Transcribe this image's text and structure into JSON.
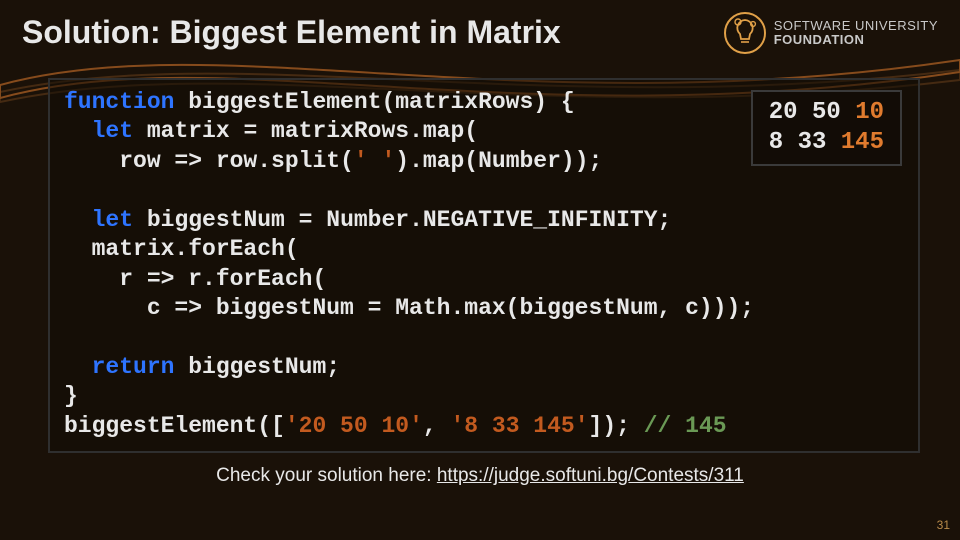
{
  "header": {
    "title": "Solution: Biggest Element in Matrix",
    "logo": {
      "line1": "SOFTWARE UNIVERSITY",
      "line2": "FOUNDATION"
    }
  },
  "code": {
    "l1a": "function",
    "l1b": " biggestElement(matrixRows) {",
    "l2a": "  ",
    "l2b": "let",
    "l2c": " matrix = matrixRows.map(",
    "l3a": "    row => row.split(",
    "l3b": "' '",
    "l3c": ").map(Number));",
    "blank1": "",
    "l4a": "  ",
    "l4b": "let",
    "l4c": " biggestNum = Number.NEGATIVE_INFINITY;",
    "l5": "  matrix.forEach(",
    "l6": "    r => r.forEach(",
    "l7": "      c => biggestNum = Math.max(biggestNum, c)));",
    "blank2": "",
    "l8a": "  ",
    "l8b": "return",
    "l8c": " biggestNum;",
    "l9": "}",
    "l10a": "biggestElement([",
    "l10b": "'20 50 10'",
    "l10c": ", ",
    "l10d": "'8 33 145'",
    "l10e": "]); ",
    "l10f": "// 145"
  },
  "inset": {
    "r1a": "20 50 ",
    "r1b": "10",
    "r2a": "8 33 ",
    "r2b": "145"
  },
  "footer": {
    "label": "Check your solution here: ",
    "link_text": "https://judge.softuni.bg/Contests/311",
    "link_href": "https://judge.softuni.bg/Contests/311"
  },
  "page_number": "31"
}
